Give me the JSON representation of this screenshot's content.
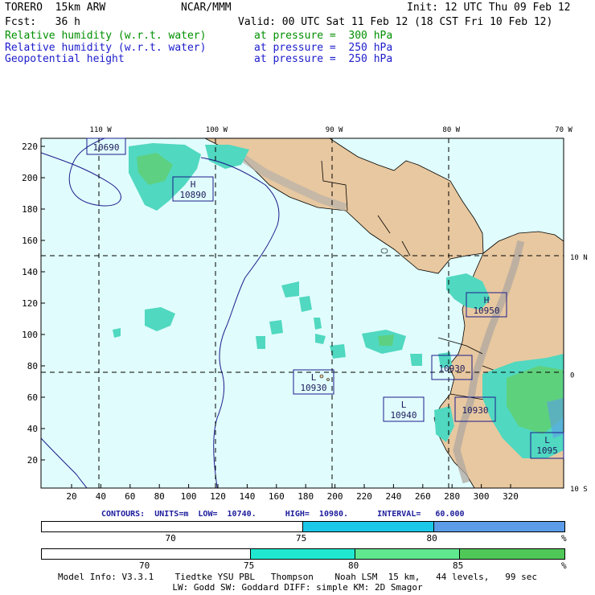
{
  "header": {
    "model": "TORERO  15km ARW",
    "org": "NCAR/MMM",
    "init": "Init: 12 UTC Thu 09 Feb 12",
    "fcst": "Fcst:   36 h",
    "valid": "Valid: 00 UTC Sat 11 Feb 12 (18 CST Fri 10 Feb 12)",
    "fields": [
      {
        "name": "Relative humidity (w.r.t. water)",
        "level": "at pressure =  300 hPa",
        "color": "#008f00"
      },
      {
        "name": "Relative humidity (w.r.t. water)",
        "level": "at pressure =  250 hPa",
        "color": "#1c1ccc"
      },
      {
        "name": "Geopotential height",
        "level": "at pressure =  250 hPa",
        "color": "#1c1ccc"
      }
    ]
  },
  "map": {
    "top_ticks": [
      {
        "label": "110 W",
        "frac": 0.114
      },
      {
        "label": "100 W",
        "frac": 0.336
      },
      {
        "label": "90 W",
        "frac": 0.561
      },
      {
        "label": "80 W",
        "frac": 0.785
      },
      {
        "label": "70 W",
        "frac": 1.0
      }
    ],
    "right_ticks": [
      {
        "label": "10 N",
        "frac": 0.338
      },
      {
        "label": "0",
        "frac": 0.675
      },
      {
        "label": "10 S",
        "frac": 1.0
      }
    ],
    "x_ticks": [
      "20",
      "40",
      "60",
      "80",
      "100",
      "120",
      "140",
      "160",
      "180",
      "200",
      "220",
      "240",
      "260",
      "280",
      "300",
      "320"
    ],
    "y_ticks": [
      "20",
      "40",
      "60",
      "80",
      "100",
      "120",
      "140",
      "160",
      "180",
      "200",
      "220"
    ],
    "pressure_centers": [
      {
        "letter": "",
        "value": "10690"
      },
      {
        "letter": "H",
        "value": "10890"
      },
      {
        "letter": "H",
        "value": "10950"
      },
      {
        "letter": "",
        "value": "10930"
      },
      {
        "letter": "L",
        "value": "10930"
      },
      {
        "letter": "L",
        "value": "10940"
      },
      {
        "letter": "",
        "value": "10930"
      },
      {
        "letter": "L",
        "value": "1095"
      }
    ],
    "colors": {
      "ocean": "#e0fcfc",
      "land": "#e8c8a0",
      "mountain": "#b8b0a8",
      "rh_low": "#40d8d8",
      "rh_mid": "#60e080",
      "rh_high": "#50b060",
      "contour": "#1c1c8c"
    }
  },
  "contour_info": "CONTOURS:  UNITS=m  LOW=  10740.      HIGH=  10980.      INTERVAL=   60.000",
  "colorbar1": {
    "segments": [
      {
        "color": "#ffffff",
        "frac": 0.5
      },
      {
        "color": "#1cc8e8",
        "frac": 0.25
      },
      {
        "color": "#5c9ce8",
        "frac": 0.25
      }
    ],
    "labels": [
      "70",
      "75",
      "80"
    ],
    "unit": "%"
  },
  "colorbar2": {
    "segments": [
      {
        "color": "#ffffff",
        "frac": 0.4
      },
      {
        "color": "#20e8d0",
        "frac": 0.2
      },
      {
        "color": "#60e890",
        "frac": 0.2
      },
      {
        "color": "#50c858",
        "frac": 0.2
      }
    ],
    "labels": [
      "70",
      "75",
      "80",
      "85"
    ],
    "unit": "%"
  },
  "footer": {
    "line1": "Model Info: V3.3.1    Tiedtke YSU PBL   Thompson    Noah LSM  15 km,   44 levels,   99 sec",
    "line2": "LW: Godd SW: Goddard DIFF: simple KM: 2D Smagor"
  }
}
